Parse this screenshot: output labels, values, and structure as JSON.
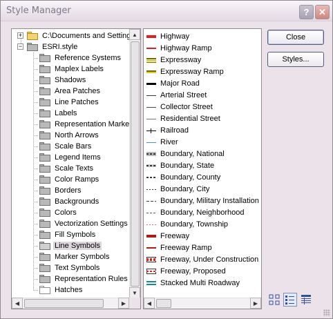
{
  "window": {
    "title": "Style Manager"
  },
  "tree": {
    "roots": [
      {
        "label": "C:\\Documents and Settings",
        "expander": "+"
      },
      {
        "label": "ESRI.style",
        "expander": "−"
      }
    ],
    "children": [
      "Reference Systems",
      "Maplex Labels",
      "Shadows",
      "Area Patches",
      "Line Patches",
      "Labels",
      "Representation Markers",
      "North Arrows",
      "Scale Bars",
      "Legend Items",
      "Scale Texts",
      "Color Ramps",
      "Borders",
      "Backgrounds",
      "Colors",
      "Vectorization Settings",
      "Fill Symbols",
      "Line Symbols",
      "Marker Symbols",
      "Text Symbols",
      "Representation Rules",
      "Hatches"
    ],
    "selected": "Line Symbols"
  },
  "symbols": [
    "Highway",
    "Highway Ramp",
    "Expressway",
    "Expressway Ramp",
    "Major Road",
    "Arterial Street",
    "Collector Street",
    "Residential Street",
    "Railroad",
    "River",
    "Boundary, National",
    "Boundary, State",
    "Boundary, County",
    "Boundary, City",
    "Boundary, Military Installation",
    "Boundary, Neighborhood",
    "Boundary, Township",
    "Freeway",
    "Freeway Ramp",
    "Freeway, Under Construction",
    "Freeway, Proposed",
    "Stacked Multi Roadway"
  ],
  "buttons": {
    "close": "Close",
    "styles": "Styles..."
  },
  "view_modes": [
    "large-icons",
    "list",
    "details"
  ],
  "active_view": "list",
  "colors": {
    "accent_red": "#e02020",
    "river_blue": "#4a8ed8",
    "selection": "#ddd7dd"
  }
}
